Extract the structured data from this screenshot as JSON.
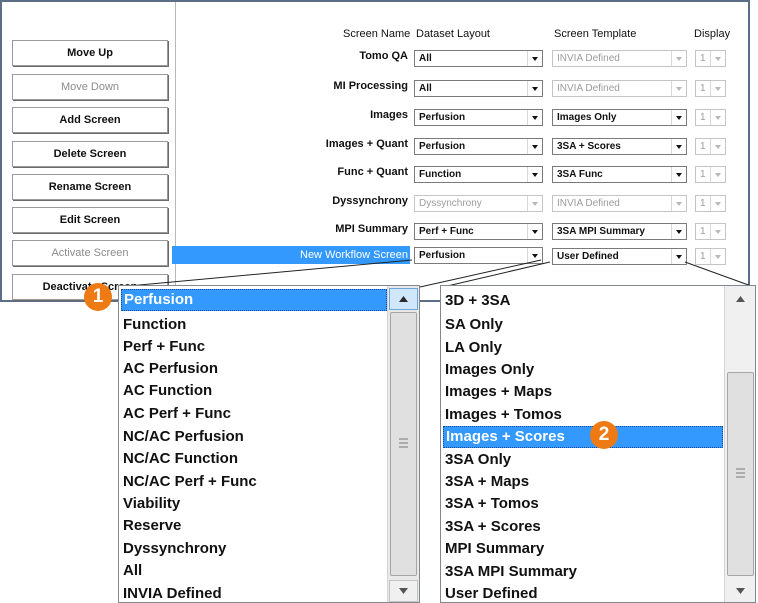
{
  "buttons": [
    "Move Up",
    "Move Down",
    "Add Screen",
    "Delete Screen",
    "Rename Screen",
    "Edit Screen",
    "Activate Screen",
    "Deactivate Screen"
  ],
  "headers": {
    "screen_name": "Screen Name",
    "dataset_layout": "Dataset Layout",
    "screen_template": "Screen Template",
    "display": "Display"
  },
  "rows": [
    {
      "name": "Tomo QA",
      "layout": "All",
      "template": "INVIA Defined",
      "display": "1"
    },
    {
      "name": "MI Processing",
      "layout": "All",
      "template": "INVIA Defined",
      "display": "1"
    },
    {
      "name": "Images",
      "layout": "Perfusion",
      "template": "Images Only",
      "display": "1"
    },
    {
      "name": "Images + Quant",
      "layout": "Perfusion",
      "template": "3SA + Scores",
      "display": "1"
    },
    {
      "name": "Func + Quant",
      "layout": "Function",
      "template": "3SA Func",
      "display": "1"
    },
    {
      "name": "Dyssynchrony",
      "layout": "Dyssynchrony",
      "template": "INVIA Defined",
      "display": "1"
    },
    {
      "name": "MPI Summary",
      "layout": "Perf + Func",
      "template": "3SA MPI Summary",
      "display": "1"
    },
    {
      "name": "New Workflow Screen",
      "layout": "Perfusion",
      "template": "User Defined",
      "display": "1"
    }
  ],
  "dataset_list": [
    "Perfusion",
    "Function",
    "Perf + Func",
    "AC Perfusion",
    "AC Function",
    "AC Perf + Func",
    "NC/AC Perfusion",
    "NC/AC Function",
    "NC/AC Perf + Func",
    "Viability",
    "Reserve",
    "Dyssynchrony",
    "All",
    "INVIA Defined"
  ],
  "template_list": [
    "3D + 3SA",
    "SA Only",
    "LA Only",
    "Images Only",
    "Images + Maps",
    "Images + Tomos",
    "Images + Scores",
    "3SA Only",
    "3SA + Maps",
    "3SA + Tomos",
    "3SA + Scores",
    "MPI Summary",
    "3SA MPI Summary",
    "User Defined"
  ],
  "badges": [
    "1",
    "2"
  ],
  "colors": {
    "selection": "#3399ff",
    "badge": "#ee7a14",
    "frame": "#5a6e86"
  }
}
